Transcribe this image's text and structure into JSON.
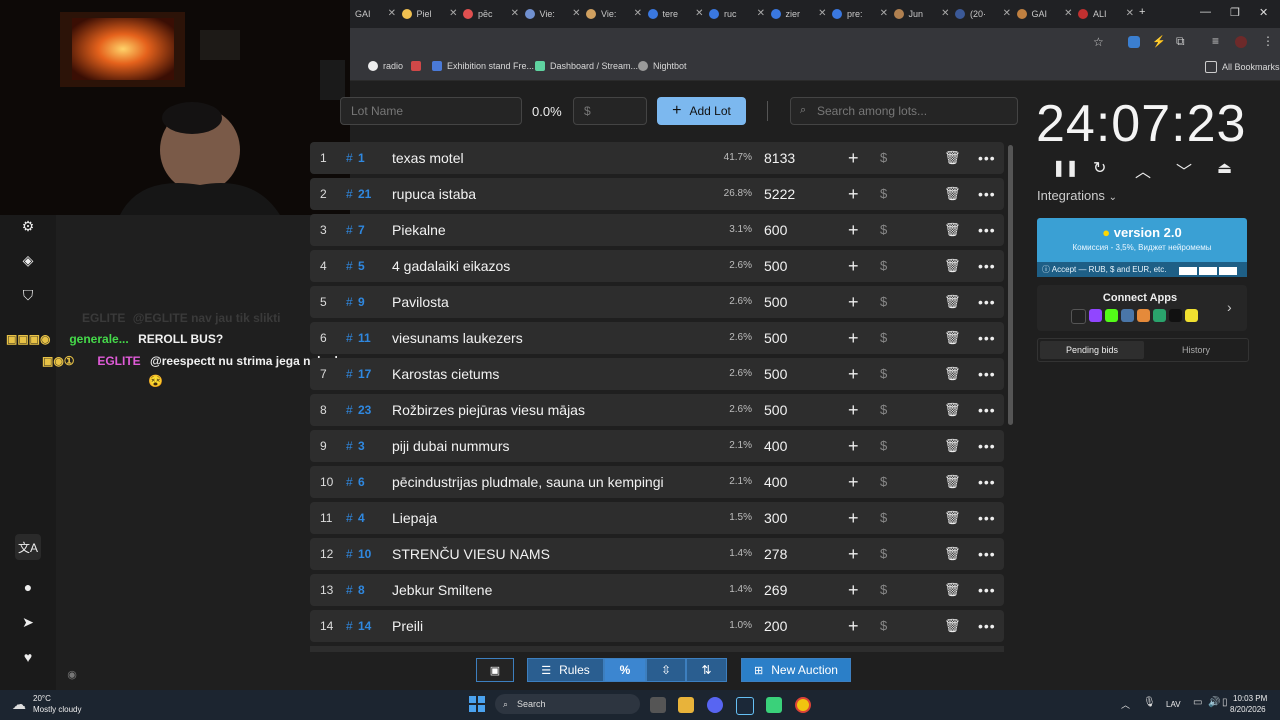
{
  "browser": {
    "tabs": [
      "GAI",
      "Piel",
      "pēc",
      "Vie:",
      "Vie:",
      "tere",
      "ruc",
      "zier",
      "pre:",
      "Jun",
      "(20·",
      "GAI",
      "ALI"
    ],
    "bookmarks": [
      "radio",
      "Exhibition stand Fre...",
      "Dashboard / Stream...",
      "Nightbot"
    ],
    "all_bookmarks": "All Bookmarks"
  },
  "controls": {
    "lot_name_placeholder": "Lot Name",
    "percent": "0.0%",
    "amount_placeholder": "$",
    "add_lot": "Add Lot",
    "search_placeholder": "Search among lots..."
  },
  "lots": [
    {
      "rank": "1",
      "id": "1",
      "name": "texas motel",
      "pct": "41.7%",
      "amount": "8133"
    },
    {
      "rank": "2",
      "id": "21",
      "name": "rupuca istaba",
      "pct": "26.8%",
      "amount": "5222"
    },
    {
      "rank": "3",
      "id": "7",
      "name": "Piekalne",
      "pct": "3.1%",
      "amount": "600"
    },
    {
      "rank": "4",
      "id": "5",
      "name": "4 gadalaiki eikazos",
      "pct": "2.6%",
      "amount": "500"
    },
    {
      "rank": "5",
      "id": "9",
      "name": "Pavilosta",
      "pct": "2.6%",
      "amount": "500"
    },
    {
      "rank": "6",
      "id": "11",
      "name": " viesunams laukezers",
      "pct": "2.6%",
      "amount": "500"
    },
    {
      "rank": "7",
      "id": "17",
      "name": "Karostas cietums",
      "pct": "2.6%",
      "amount": "500"
    },
    {
      "rank": "8",
      "id": "23",
      "name": "Rožbirzes piejūras viesu mājas",
      "pct": "2.6%",
      "amount": "500"
    },
    {
      "rank": "9",
      "id": "3",
      "name": "piji dubai nummurs",
      "pct": "2.1%",
      "amount": "400"
    },
    {
      "rank": "10",
      "id": "6",
      "name": "pēcindustrijas pludmale, sauna un kempingi",
      "pct": "2.1%",
      "amount": "400"
    },
    {
      "rank": "11",
      "id": "4",
      "name": "Liepaja",
      "pct": "1.5%",
      "amount": "300"
    },
    {
      "rank": "12",
      "id": "10",
      "name": "STRENČU VIESU NAMS",
      "pct": "1.4%",
      "amount": "278"
    },
    {
      "rank": "13",
      "id": "8",
      "name": "Jebkur Smiltene",
      "pct": "1.4%",
      "amount": "269"
    },
    {
      "rank": "14",
      "id": "14",
      "name": "Preili",
      "pct": "1.0%",
      "amount": "200"
    }
  ],
  "timer": "24:07:23",
  "integrations": "Integrations",
  "donate": {
    "title": "version 2.0",
    "subtitle": "Комиссия - 3,5%, Виджет нейромемы",
    "accept": "Accept — RUB, $ and EUR, etc."
  },
  "connect_apps": "Connect Apps",
  "bid_tabs": {
    "pending": "Pending bids",
    "history": "History"
  },
  "chat": [
    {
      "user": "EGLITE",
      "text": "nav jau tik slikti",
      "faded": true
    },
    {
      "user": "generale...",
      "text": "REROLL BUS?",
      "color": "#45d94a"
    },
    {
      "user": "EGLITE",
      "text": "@reespectt nu strima jega nekada",
      "color": "#e05bd8"
    }
  ],
  "toolbar": {
    "rules": "Rules",
    "new_auction": "New Auction"
  },
  "taskbar": {
    "weather_temp": "20°C",
    "weather_desc": "Mostly cloudy",
    "search": "Search",
    "lang": "LAV",
    "time": "10:03 PM",
    "date": "8/20/2026"
  }
}
